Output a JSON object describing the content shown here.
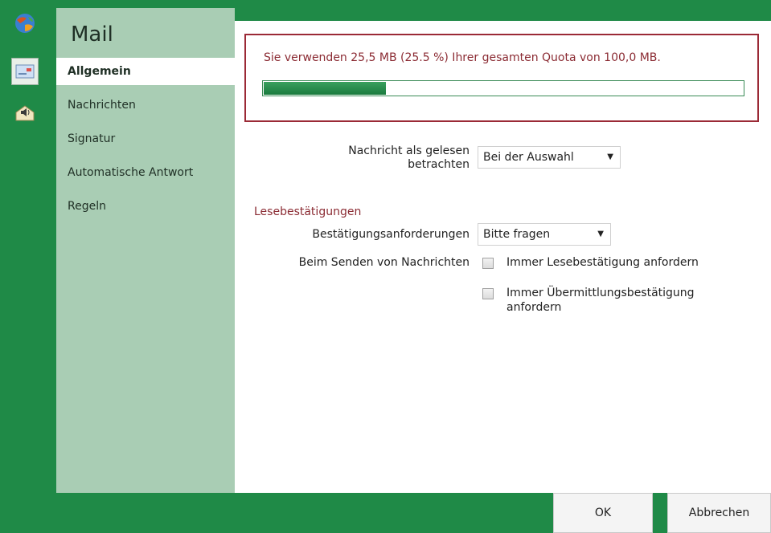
{
  "app": {
    "title": "Mail"
  },
  "rail": {
    "icons": [
      "globe-icon",
      "mail-settings-icon",
      "speaker-mail-icon"
    ]
  },
  "sidebar": {
    "items": [
      {
        "label": "Allgemein",
        "active": true
      },
      {
        "label": "Nachrichten",
        "active": false
      },
      {
        "label": "Signatur",
        "active": false
      },
      {
        "label": "Automatische Antwort",
        "active": false
      },
      {
        "label": "Regeln",
        "active": false
      }
    ]
  },
  "quota": {
    "text": "Sie verwenden 25,5 MB (25.5 %) Ihrer gesamten Quota von 100,0 MB.",
    "percent": 25.5
  },
  "settings": {
    "mark_read": {
      "label": "Nachricht als gelesen betrachten",
      "value": "Bei der Auswahl"
    },
    "read_receipts": {
      "section": "Lesebestätigungen",
      "request_label": "Bestätigungsanforderungen",
      "request_value": "Bitte fragen",
      "sending_label": "Beim Senden von Nachrichten",
      "always_read": "Immer Lesebestätigung anfordern",
      "always_delivery": "Immer Übermittlungsbestätigung anfordern"
    }
  },
  "buttons": {
    "ok": "OK",
    "cancel": "Abbrechen"
  },
  "colors": {
    "frame": "#1f8a47",
    "sidebar": "#a9cdb4",
    "accent": "#8b2b33"
  }
}
